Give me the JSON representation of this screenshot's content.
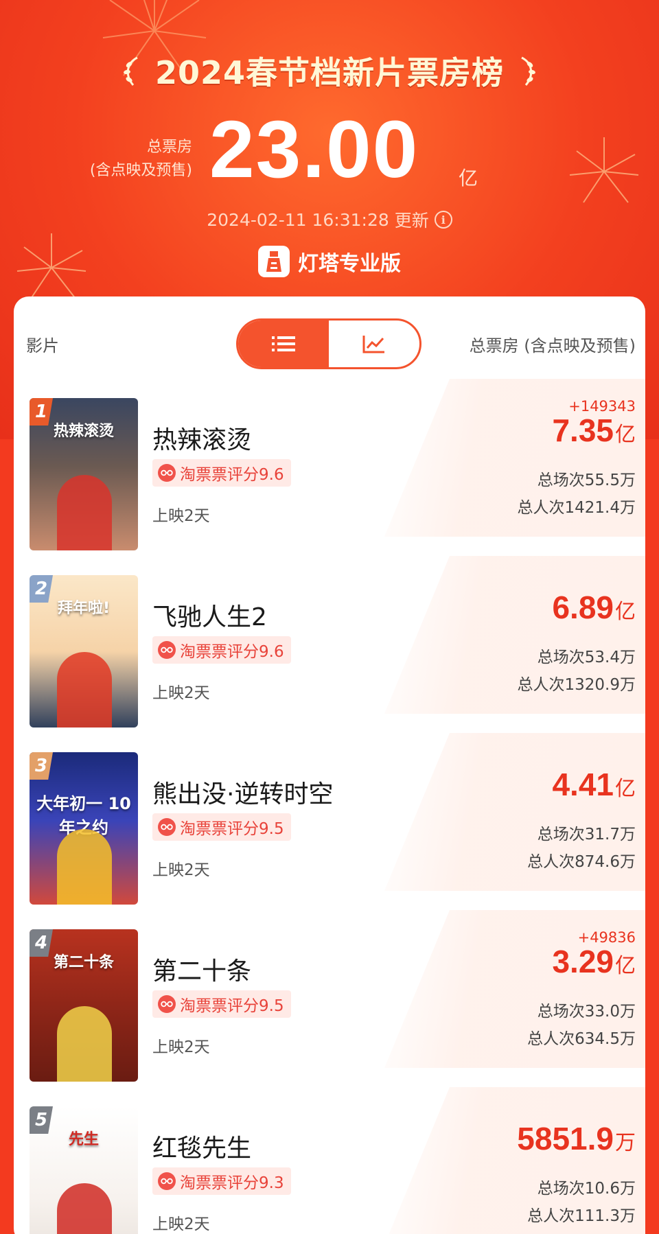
{
  "header": {
    "title": "2024春节档新片票房榜",
    "total_label_line1": "总票房",
    "total_label_line2": "(含点映及预售)",
    "total_value": "23.00",
    "total_unit": "亿",
    "update_time": "2024-02-11 16:31:28",
    "update_suffix": "更新",
    "brand": "灯塔专业版"
  },
  "table_header": {
    "left": "影片",
    "right": "总票房 (含点映及预售)",
    "toggle": [
      "list-icon",
      "trend-chart-icon"
    ]
  },
  "movies": [
    {
      "rank": "1",
      "title": "热辣滚烫",
      "rating": "淘票票评分9.6",
      "days": "上映2天",
      "delta": "+149343",
      "box_value": "7.35",
      "box_unit": "亿",
      "sessions": "总场次55.5万",
      "people": "总人次1421.4万",
      "poster_text": "热辣滚烫",
      "rank_color": "#e85a2a"
    },
    {
      "rank": "2",
      "title": "飞驰人生2",
      "rating": "淘票票评分9.6",
      "days": "上映2天",
      "delta": "",
      "box_value": "6.89",
      "box_unit": "亿",
      "sessions": "总场次53.4万",
      "people": "总人次1320.9万",
      "poster_text": "拜年啦!",
      "rank_color": "#8aa3c8"
    },
    {
      "rank": "3",
      "title": "熊出没·逆转时空",
      "rating": "淘票票评分9.5",
      "days": "上映2天",
      "delta": "",
      "box_value": "4.41",
      "box_unit": "亿",
      "sessions": "总场次31.7万",
      "people": "总人次874.6万",
      "poster_text": "大年初一 10年之约",
      "rank_color": "#e3a068"
    },
    {
      "rank": "4",
      "title": "第二十条",
      "rating": "淘票票评分9.5",
      "days": "上映2天",
      "delta": "+49836",
      "box_value": "3.29",
      "box_unit": "亿",
      "sessions": "总场次33.0万",
      "people": "总人次634.5万",
      "poster_text": "第二十条",
      "rank_color": "#7b7f86"
    },
    {
      "rank": "5",
      "title": "红毯先生",
      "rating": "淘票票评分9.3",
      "days": "上映2天",
      "delta": "",
      "box_value": "5851.9",
      "box_unit": "万",
      "sessions": "总场次10.6万",
      "people": "总人次111.3万",
      "poster_text": "先生",
      "rank_color": "#7b7f86"
    }
  ],
  "colors": {
    "brand_red": "#f4532d",
    "box_red": "#e8331f"
  }
}
